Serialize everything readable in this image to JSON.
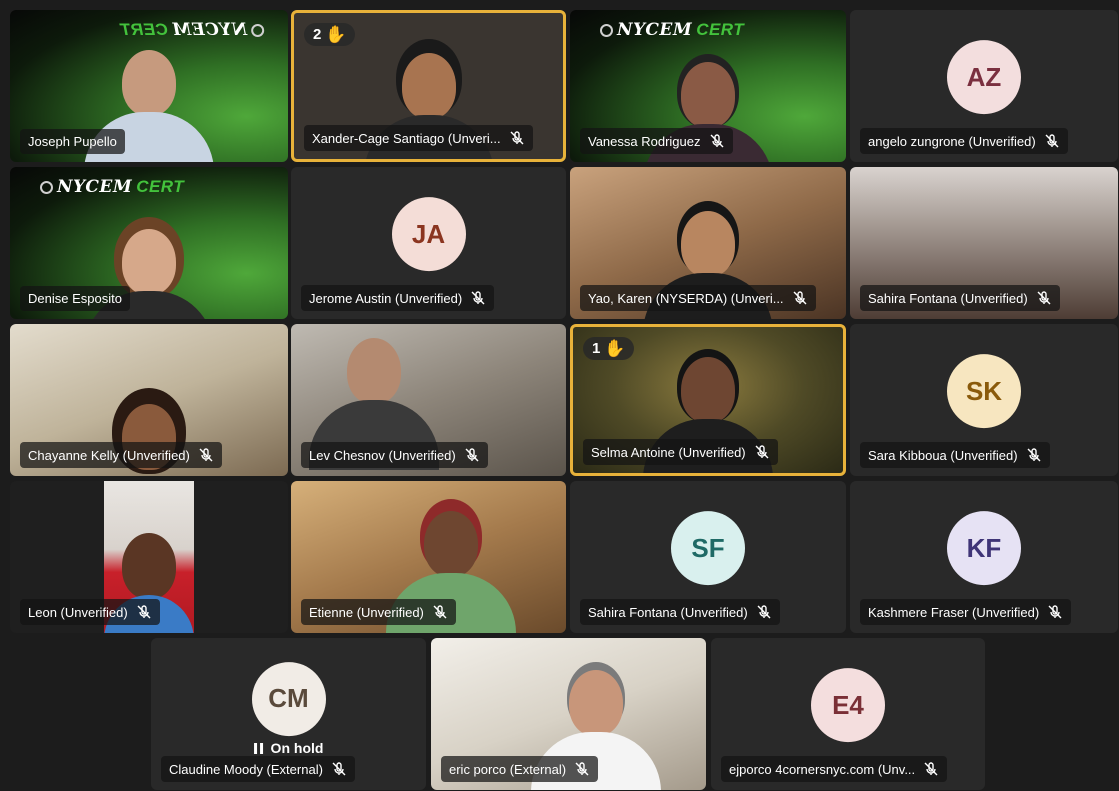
{
  "colors": {
    "hand_border": "#e8b23a",
    "cert_green": "#43c23c",
    "tile_bg": "#292929",
    "page_bg": "#1c1c1c"
  },
  "icons": {
    "mute": "microphone-muted-icon",
    "hand": "raised-hand-icon",
    "hold": "pause-icon"
  },
  "banner": {
    "org": "NYCEM",
    "program": "CERT",
    "mirrored_text": "NYCEM | CERT"
  },
  "participants": [
    {
      "name": "Joseph Pupello",
      "muted": false,
      "type": "video"
    },
    {
      "name": "Xander-Cage Santiago (Unveri...",
      "muted": true,
      "type": "video",
      "hand_raised": true,
      "hand_order": "2"
    },
    {
      "name": "Vanessa Rodriguez",
      "muted": true,
      "type": "video"
    },
    {
      "name": "angelo zungrone (Unverified)",
      "muted": true,
      "type": "avatar",
      "initials": "AZ",
      "avatar_color": "#f3dede",
      "initials_color": "#7a2f3f"
    },
    {
      "name": "Denise Esposito",
      "muted": false,
      "type": "video"
    },
    {
      "name": "Jerome Austin (Unverified)",
      "muted": true,
      "type": "avatar",
      "initials": "JA",
      "avatar_color": "#f4ddd7",
      "initials_color": "#8b3520"
    },
    {
      "name": "Yao, Karen (NYSERDA) (Unveri...",
      "muted": true,
      "type": "video"
    },
    {
      "name": "Sahira Fontana (Unverified)",
      "muted": true,
      "type": "video"
    },
    {
      "name": "Chayanne Kelly (Unverified)",
      "muted": true,
      "type": "video"
    },
    {
      "name": "Lev Chesnov (Unverified)",
      "muted": true,
      "type": "video"
    },
    {
      "name": "Selma Antoine (Unverified)",
      "muted": true,
      "type": "video",
      "hand_raised": true,
      "hand_order": "1"
    },
    {
      "name": "Sara Kibboua (Unverified)",
      "muted": true,
      "type": "avatar",
      "initials": "SK",
      "avatar_color": "#f7e6c0",
      "initials_color": "#8a5a0b"
    },
    {
      "name": "Leon (Unverified)",
      "muted": true,
      "type": "video"
    },
    {
      "name": "Etienne (Unverified)",
      "muted": true,
      "type": "video"
    },
    {
      "name": "Sahira Fontana (Unverified)",
      "muted": true,
      "type": "avatar",
      "initials": "SF",
      "avatar_color": "#d9f0ee",
      "initials_color": "#1f6a66"
    },
    {
      "name": "Kashmere Fraser (Unverified)",
      "muted": true,
      "type": "avatar",
      "initials": "KF",
      "avatar_color": "#e6e2f4",
      "initials_color": "#3f3477"
    },
    {
      "name": "Claudine Moody (External)",
      "muted": true,
      "type": "avatar",
      "initials": "CM",
      "avatar_color": "#f1ece6",
      "initials_color": "#5a4a3b",
      "status": "On hold"
    },
    {
      "name": "eric porco (External)",
      "muted": true,
      "type": "video"
    },
    {
      "name": "ejporco 4cornersnyc.com (Unv...",
      "muted": true,
      "type": "avatar",
      "initials": "E4",
      "avatar_color": "#f4dede",
      "initials_color": "#7a2f36"
    }
  ]
}
